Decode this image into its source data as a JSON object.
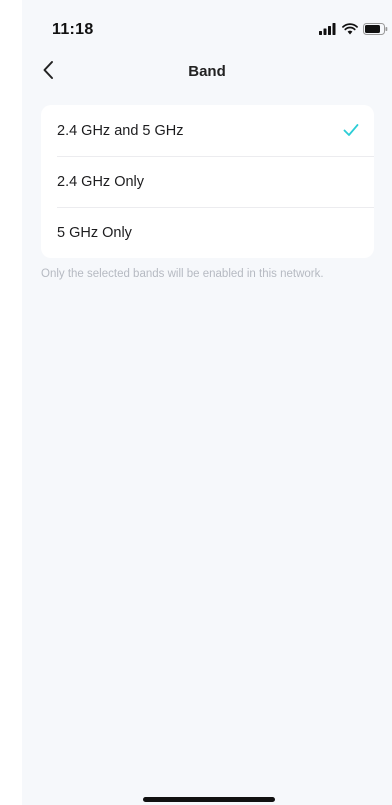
{
  "status_bar": {
    "time": "11:18",
    "icons": [
      "cellular-signal-icon",
      "wifi-icon",
      "battery-icon"
    ]
  },
  "nav": {
    "title": "Band",
    "back_icon": "chevron-left-icon"
  },
  "band_options": [
    {
      "label": "2.4 GHz and 5 GHz",
      "selected": true
    },
    {
      "label": "2.4 GHz Only",
      "selected": false
    },
    {
      "label": "5 GHz Only",
      "selected": false
    }
  ],
  "footnote": "Only the selected bands will be enabled in this network.",
  "colors": {
    "accent": "#2ccdd6",
    "background": "#f6f8fb",
    "card": "#ffffff"
  }
}
